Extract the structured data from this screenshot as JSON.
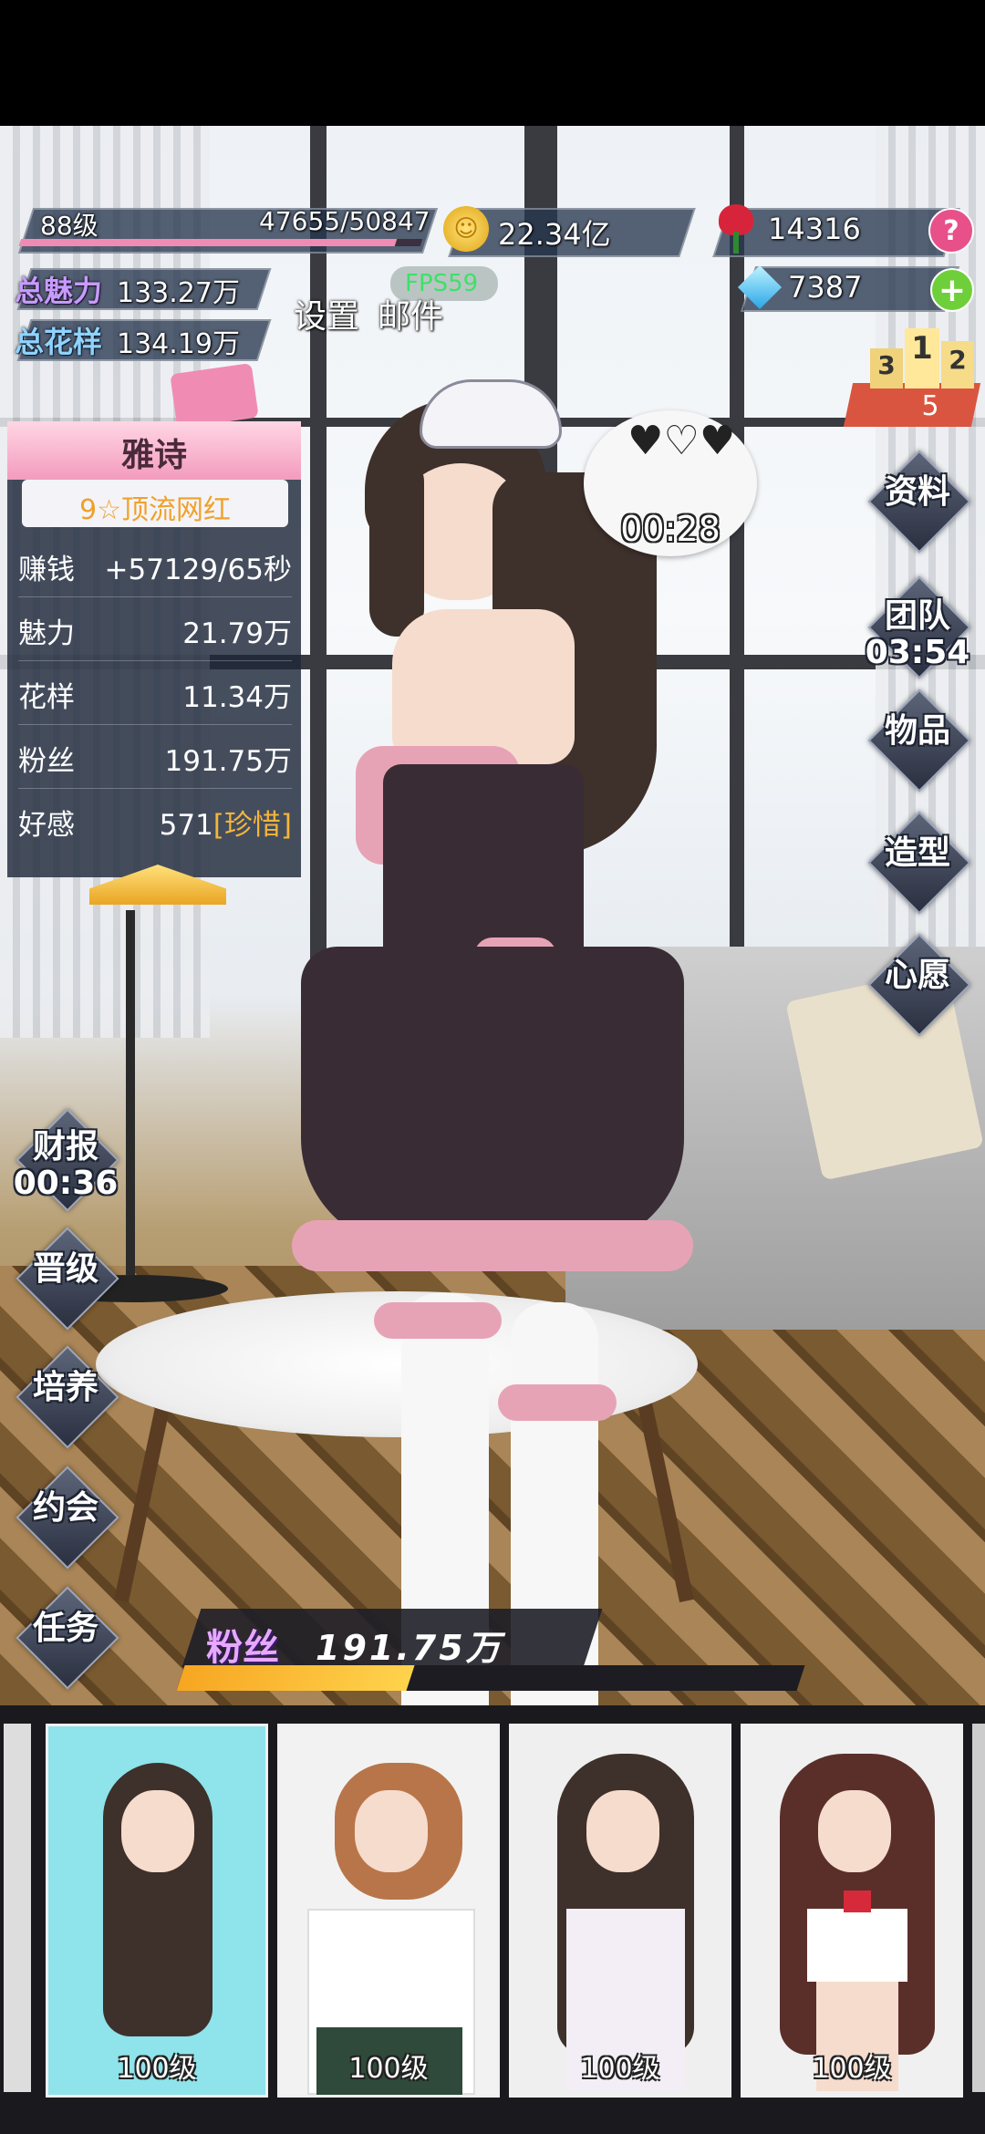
{
  "hud": {
    "level": "88级",
    "exp": "47655/50847",
    "exp_progress": 0.937,
    "gold": "22.34亿",
    "rose": "14316",
    "diamond": "7387",
    "help_symbol": "?",
    "plus_symbol": "+",
    "total_charm_label": "总魅力",
    "total_charm_value": "133.27万",
    "total_style_label": "总花样",
    "total_style_value": "134.19万",
    "settings": "设置",
    "mail": "邮件",
    "fps": "FPS59"
  },
  "rank_badge": {
    "first": "1",
    "second": "2",
    "third": "3",
    "value": "5"
  },
  "heart_bubble": {
    "timer": "00:28"
  },
  "character": {
    "name": "雅诗",
    "title": "9☆顶流网红",
    "stats": [
      {
        "label": "赚钱",
        "value": "+57129/65秒"
      },
      {
        "label": "魅力",
        "value": "21.79万"
      },
      {
        "label": "花样",
        "value": "11.34万"
      },
      {
        "label": "粉丝",
        "value": "191.75万"
      },
      {
        "label": "好感",
        "value": "571",
        "extra": "[珍惜]"
      }
    ]
  },
  "right_menu": {
    "profile": "资料",
    "team": "团队",
    "team_timer": "03:54",
    "items": "物品",
    "styling": "造型",
    "wish": "心愿"
  },
  "left_menu": {
    "finance": "财报",
    "finance_timer": "00:36",
    "promote": "晋级",
    "train": "培养",
    "date": "约会",
    "tasks": "任务"
  },
  "fans_bar": {
    "label": "粉丝",
    "value": "191.75万",
    "progress": 0.37
  },
  "cards": [
    {
      "level": "100级",
      "bg": "#8fe3ea"
    },
    {
      "level": "100级",
      "bg": "#f2f2f2"
    },
    {
      "level": "100级",
      "bg": "#efefef"
    },
    {
      "level": "100级",
      "bg": "#f0f0f0"
    }
  ],
  "colors": {
    "accent_pink": "#f08cb4",
    "gold": "#f5b53a",
    "panel": "#1e283a",
    "rank": "#e36b52"
  }
}
